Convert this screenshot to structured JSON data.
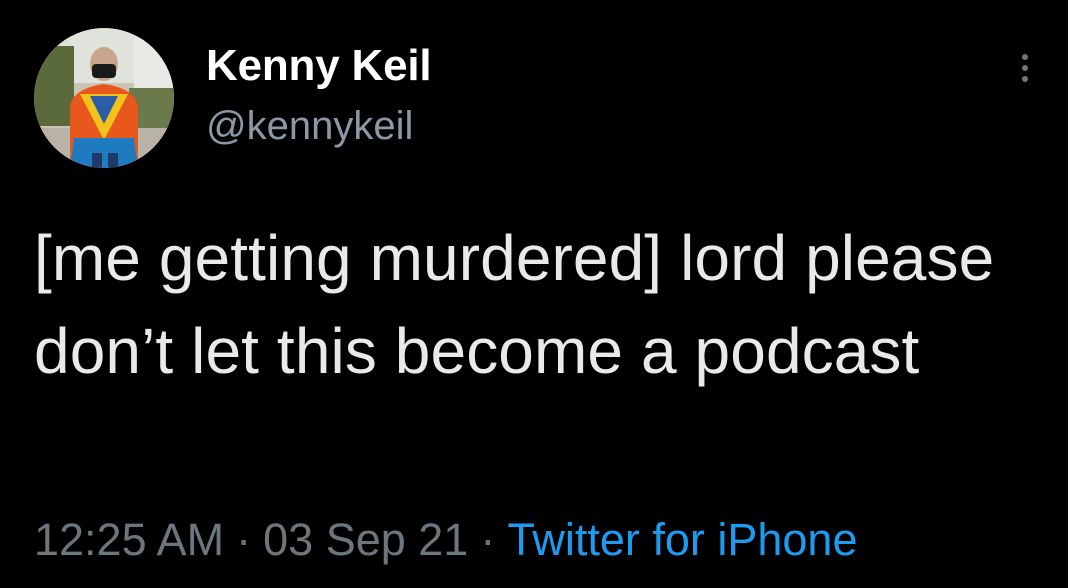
{
  "tweet": {
    "author": {
      "display_name": "Kenny Keil",
      "handle": "@kennykeil",
      "avatar_icon": "profile-photo"
    },
    "text": "[me getting murdered] lord please don’t let this become a podcast",
    "meta": {
      "time": "12:25 AM",
      "separator": "·",
      "date": "03 Sep 21",
      "source": "Twitter for iPhone"
    },
    "more_icon": "more-vertical-icon"
  },
  "colors": {
    "background": "#000000",
    "text": "#e7e9ea",
    "secondary": "#6e767d",
    "handle": "#8b98a5",
    "accent": "#1d9bf0"
  }
}
